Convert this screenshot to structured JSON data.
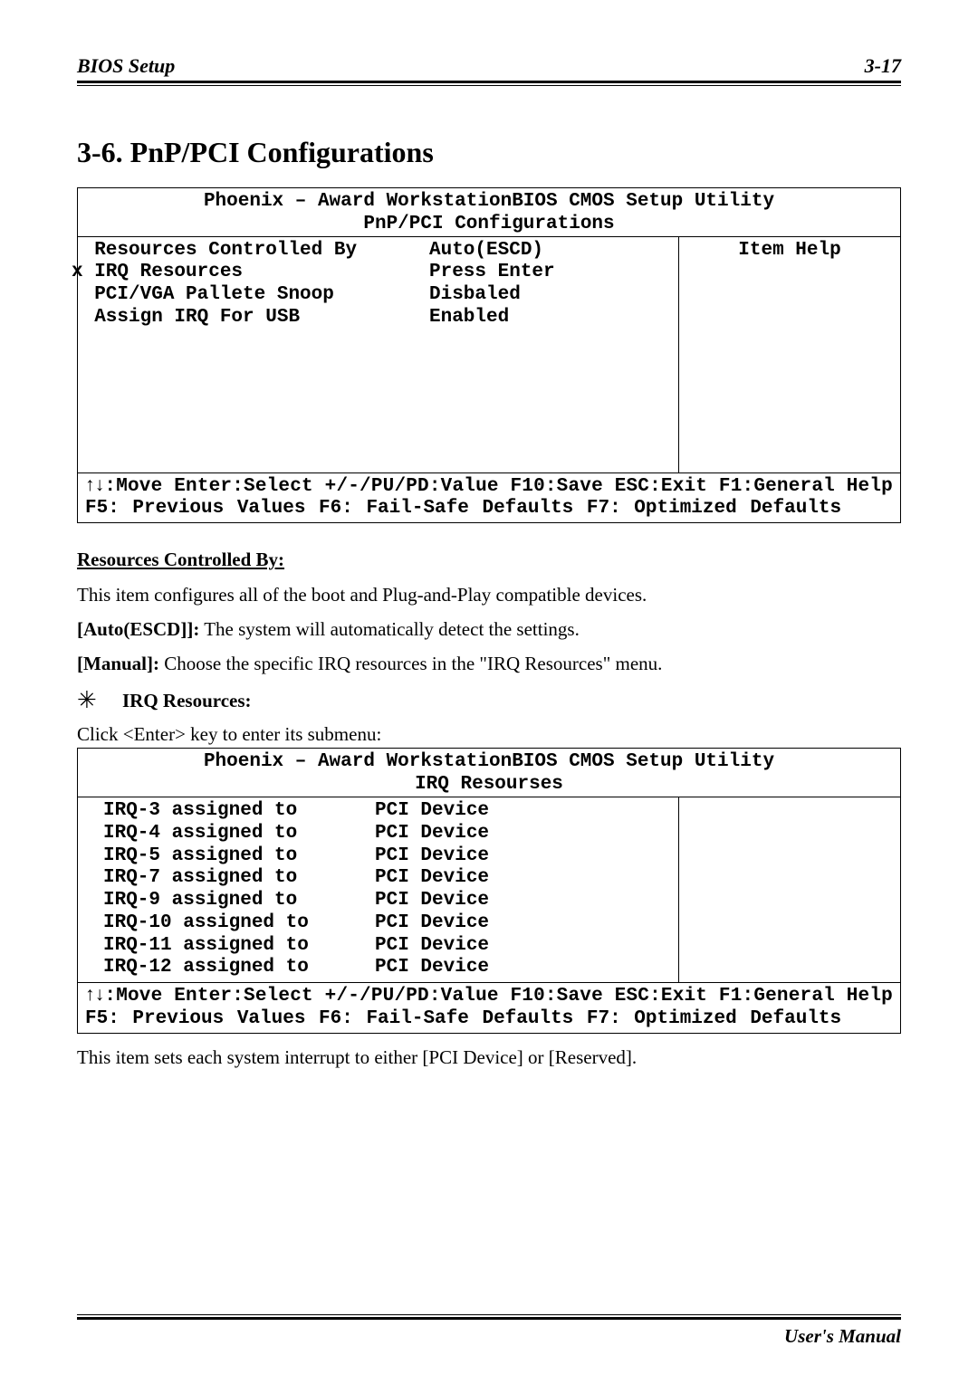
{
  "header": {
    "left": "BIOS Setup",
    "right": "3-17"
  },
  "section_title": "3-6.  PnP/PCI Configurations",
  "bios1": {
    "title": "Phoenix – Award WorkstationBIOS CMOS Setup Utility",
    "subtitle": "PnP/PCI Configurations",
    "side_title": "Item Help",
    "rows": [
      {
        "label": "  Resources Controlled By",
        "value": "Auto(ESCD)"
      },
      {
        "label": "x IRQ Resources",
        "value": "Press Enter"
      },
      {
        "label": "",
        "value": ""
      },
      {
        "label": "  PCI/VGA Pallete Snoop",
        "value": "Disbaled"
      },
      {
        "label": "  Assign IRQ For USB",
        "value": "Enabled"
      }
    ],
    "footer1": ":Move Enter:Select +/-/PU/PD:Value F10:Save ESC:Exit F1:General Help",
    "footer2": "F5: Previous Values  F6: Fail-Safe Defaults  F7: Optimized Defaults"
  },
  "desc": {
    "heading1": "Resources Controlled By:",
    "text1": "This item configures all of the boot and Plug-and-Play compatible devices.",
    "opt1_label": "[Auto(ESCD]]:",
    "opt1_text": " The system will automatically detect the settings.",
    "opt2_label": "[Manual]:",
    "opt2_text": " Choose the specific IRQ resources in the \"IRQ Resources\" menu.",
    "star_label": "IRQ Resources:",
    "submenu_text": "Click <Enter> key to enter its submenu:"
  },
  "bios2": {
    "title": "Phoenix – Award WorkstationBIOS CMOS Setup Utility",
    "subtitle": "IRQ Resourses",
    "rows": [
      {
        "label": "IRQ-3 assigned to",
        "value": "PCI Device"
      },
      {
        "label": "IRQ-4 assigned to",
        "value": "PCI Device"
      },
      {
        "label": "IRQ-5 assigned to",
        "value": "PCI Device"
      },
      {
        "label": "IRQ-7 assigned to",
        "value": "PCI Device"
      },
      {
        "label": "IRQ-9 assigned to",
        "value": "PCI Device"
      },
      {
        "label": "IRQ-10 assigned to",
        "value": "PCI Device"
      },
      {
        "label": "IRQ-11 assigned to",
        "value": "PCI Device"
      },
      {
        "label": "IRQ-12 assigned to",
        "value": "PCI Device"
      }
    ],
    "footer1": ":Move Enter:Select +/-/PU/PD:Value F10:Save ESC:Exit F1:General Help",
    "footer2": "F5: Previous Values  F6: Fail-Safe Defaults  F7: Optimized Defaults"
  },
  "final_text": "This item sets each system interrupt to either [PCI Device] or [Reserved].",
  "footer": "User's Manual"
}
